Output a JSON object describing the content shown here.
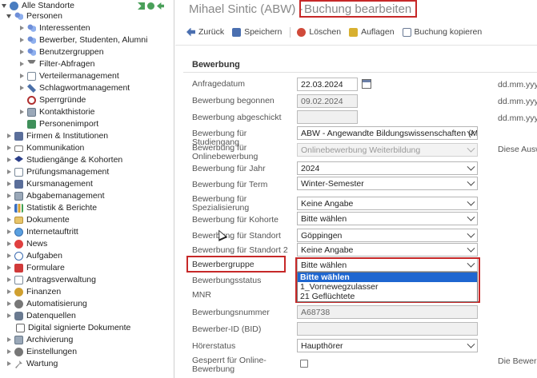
{
  "sidebar": {
    "items": [
      {
        "label": "Alle Standorte",
        "icon": "globe-icon"
      },
      {
        "label": "Personen",
        "icon": "users-icon"
      },
      {
        "label": "Interessenten",
        "icon": "users-icon"
      },
      {
        "label": "Bewerber, Studenten, Alumni",
        "icon": "users-icon"
      },
      {
        "label": "Benutzergruppen",
        "icon": "users-icon"
      },
      {
        "label": "Filter-Abfragen",
        "icon": "filter-icon"
      },
      {
        "label": "Verteilermanagement",
        "icon": "document-icon"
      },
      {
        "label": "Schlagwortmanagement",
        "icon": "tag-icon"
      },
      {
        "label": "Sperrgründe",
        "icon": "ban-icon"
      },
      {
        "label": "Kontakthistorie",
        "icon": "history-icon"
      },
      {
        "label": "Personenimport",
        "icon": "import-icon"
      },
      {
        "label": "Firmen & Institutionen",
        "icon": "building-icon"
      },
      {
        "label": "Kommunikation",
        "icon": "mail-icon"
      },
      {
        "label": "Studiengänge & Kohorten",
        "icon": "graduation-cap-icon"
      },
      {
        "label": "Prüfungsmanagement",
        "icon": "document-icon"
      },
      {
        "label": "Kursmanagement",
        "icon": "book-icon"
      },
      {
        "label": "Abgabemanagement",
        "icon": "inbox-icon"
      },
      {
        "label": "Statistik & Berichte",
        "icon": "chart-icon"
      },
      {
        "label": "Dokumente",
        "icon": "folder-icon"
      },
      {
        "label": "Internetauftritt",
        "icon": "globe-icon"
      },
      {
        "label": "News",
        "icon": "news-icon"
      },
      {
        "label": "Aufgaben",
        "icon": "clock-icon"
      },
      {
        "label": "Formulare",
        "icon": "form-icon"
      },
      {
        "label": "Antragsverwaltung",
        "icon": "document-icon"
      },
      {
        "label": "Finanzen",
        "icon": "coins-icon"
      },
      {
        "label": "Automatisierung",
        "icon": "gear-icon"
      },
      {
        "label": "Datenquellen",
        "icon": "database-icon"
      },
      {
        "label": "Digital signierte Dokumente",
        "icon": "signature-icon"
      },
      {
        "label": "Archivierung",
        "icon": "archive-icon"
      },
      {
        "label": "Einstellungen",
        "icon": "gear-icon"
      },
      {
        "label": "Wartung",
        "icon": "wrench-icon"
      }
    ]
  },
  "header": {
    "title_prefix": "Mihael Sintic (ABW) -",
    "title_action": "Buchung bearbeiten"
  },
  "toolbar": {
    "back": "Zurück",
    "save": "Speichern",
    "delete": "Löschen",
    "requirements": "Auflagen",
    "copy": "Buchung kopieren"
  },
  "form": {
    "section_title": "Bewerbung",
    "fields": {
      "anfragedatum": {
        "label": "Anfragedatum",
        "value": "22.03.2024",
        "hint": "dd.mm.yyy"
      },
      "begonnen": {
        "label": "Bewerbung begonnen",
        "value": "09.02.2024",
        "hint": "dd.mm.yyy"
      },
      "abgeschickt": {
        "label": "Bewerbung abgeschickt",
        "value": "",
        "hint": "dd.mm.yyy"
      },
      "studiengang": {
        "label": "Bewerbung für Studiengang",
        "value": "ABW - Angewandte Bildungswissenschaften (M"
      },
      "onlinebewerbung": {
        "label": "Bewerbung für Onlinebewerbung",
        "value": "Onlinebewerbung Weiterbildung",
        "hint": "Diese Ausw"
      },
      "jahr": {
        "label": "Bewerbung für Jahr",
        "value": "2024"
      },
      "term": {
        "label": "Bewerbung für Term",
        "value": "Winter-Semester"
      },
      "spezialisierung": {
        "label": "Bewerbung für Spezialisierung",
        "value": "Keine Angabe"
      },
      "kohorte": {
        "label": "Bewerbung für Kohorte",
        "value": "Bitte wählen"
      },
      "standort": {
        "label": "Bewerbung für Standort",
        "value": "Göppingen"
      },
      "standort2": {
        "label": "Bewerbung für Standort 2",
        "value": "Keine Angabe"
      },
      "bewerbergruppe": {
        "label": "Bewerbergruppe",
        "value": "Bitte wählen",
        "options": [
          "Bitte wählen",
          "1_Vornewegzulasser",
          "21 Geflüchtete"
        ]
      },
      "bewerbungsstatus": {
        "label": "Bewerbungsstatus"
      },
      "mnr": {
        "label": "MNR"
      },
      "bewerbungsnummer": {
        "label": "Bewerbungsnummer",
        "value": "A68738"
      },
      "bewerber_id": {
        "label": "Bewerber-ID (BID)",
        "value": ""
      },
      "hoererstatus": {
        "label": "Hörerstatus",
        "value": "Haupthörer"
      },
      "gesperrt": {
        "label": "Gesperrt für Online-Bewerbung",
        "hint": "Die Bewerb"
      }
    }
  },
  "colors": {
    "highlight": "#c62828",
    "selected_option": "#1e66d0"
  }
}
